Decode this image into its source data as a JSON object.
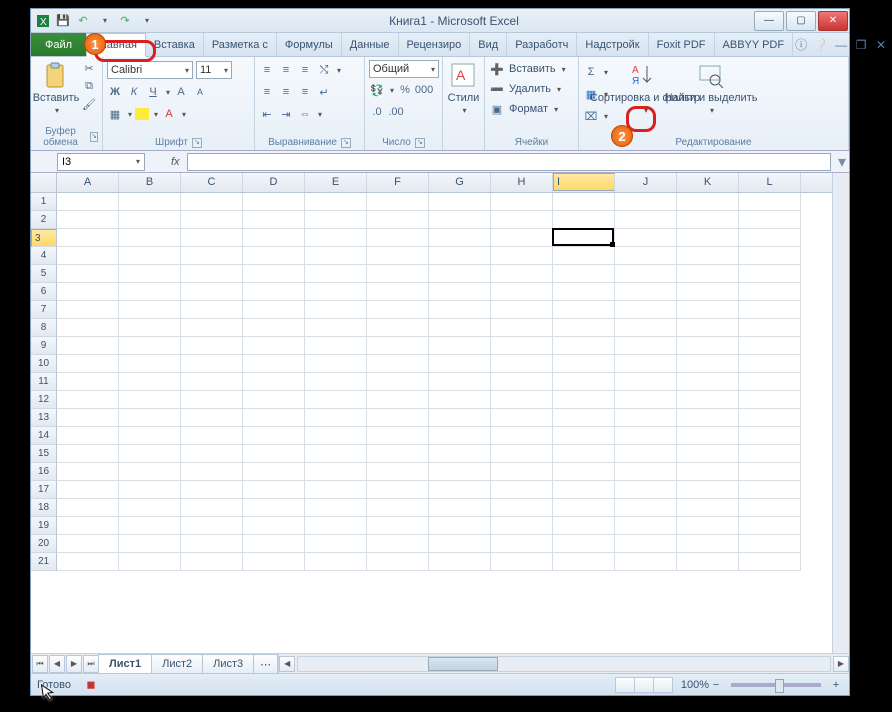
{
  "title": "Книга1  -  Microsoft Excel",
  "qat": {
    "save": "💾",
    "undo": "↶",
    "redo": "↷"
  },
  "tabs": {
    "file": "Файл",
    "items": [
      "Главная",
      "Вставка",
      "Разметка с",
      "Формулы",
      "Данные",
      "Рецензиро",
      "Вид",
      "Разработч",
      "Надстройк",
      "Foxit PDF",
      "ABBYY PDF"
    ],
    "activeIndex": 0
  },
  "ribbon": {
    "clipboard": {
      "label": "Буфер обмена",
      "paste": "Вставить"
    },
    "font": {
      "label": "Шрифт",
      "name": "Calibri",
      "size": "11"
    },
    "align": {
      "label": "Выравнивание"
    },
    "number": {
      "label": "Число",
      "format": "Общий"
    },
    "styles": {
      "label": "",
      "btn": "Стили"
    },
    "cells": {
      "label": "Ячейки",
      "insert": "Вставить",
      "delete": "Удалить",
      "format": "Формат"
    },
    "editing": {
      "label": "Редактирование",
      "sort": "Сортировка и фильтр",
      "find": "Найти и выделить"
    }
  },
  "namebox": "I3",
  "fx": "fx",
  "columns": [
    "A",
    "B",
    "C",
    "D",
    "E",
    "F",
    "G",
    "H",
    "I",
    "J",
    "K",
    "L"
  ],
  "rowCount": 21,
  "activeCell": {
    "colIndex": 8,
    "rowIndex": 2
  },
  "sheets": {
    "items": [
      "Лист1",
      "Лист2",
      "Лист3"
    ],
    "activeIndex": 0
  },
  "status": {
    "ready": "Готово",
    "zoom": "100%"
  },
  "annotations": {
    "badge1": "1",
    "badge2": "2"
  }
}
